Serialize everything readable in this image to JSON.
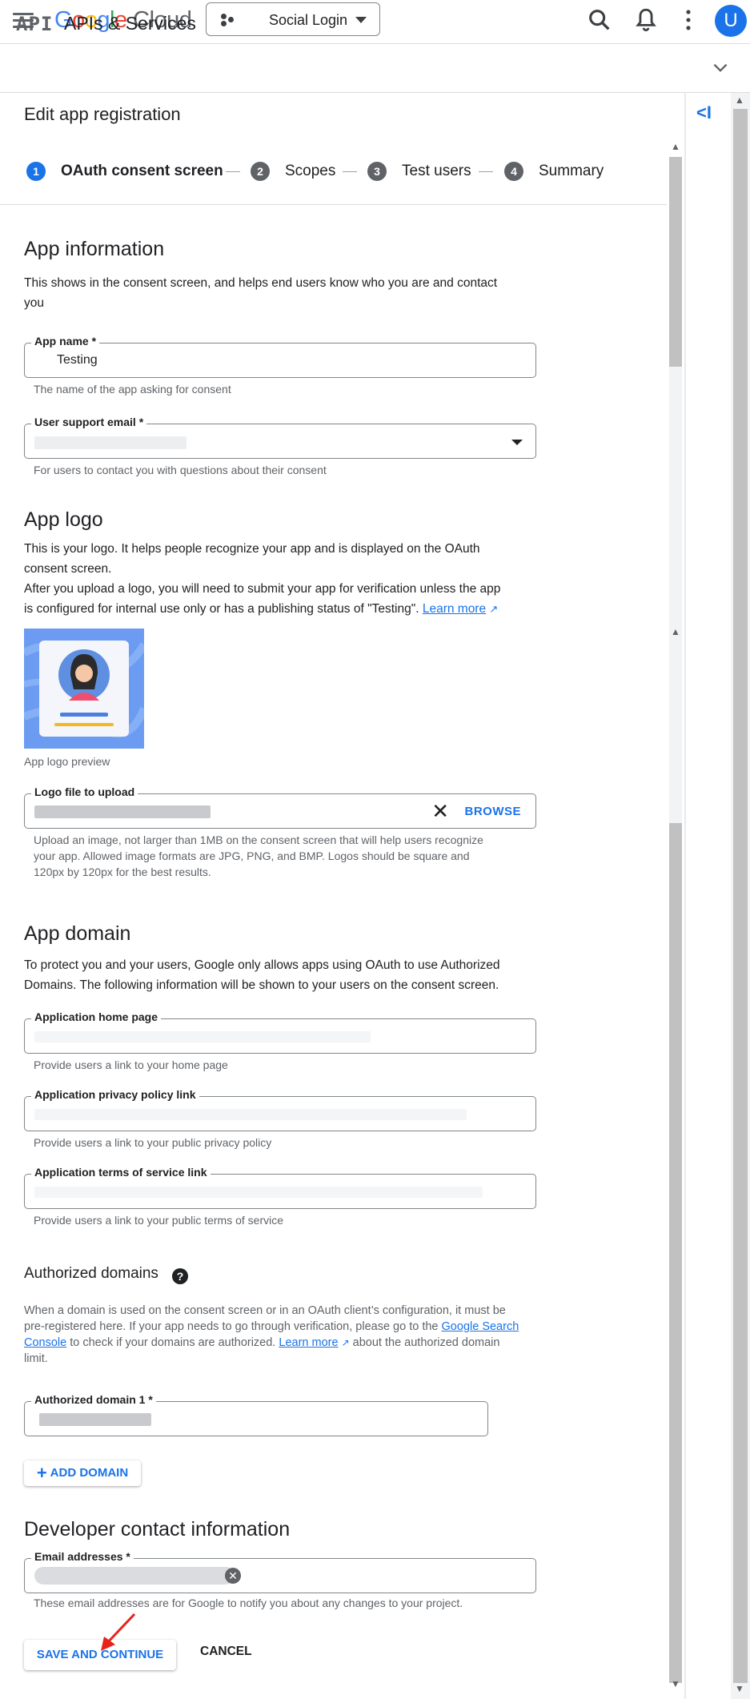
{
  "topbar": {
    "logo_google": "Google",
    "logo_cloud": "Cloud",
    "project_name": "Social Login",
    "avatar_initial": "U"
  },
  "api_bar": {
    "logo_text": "API",
    "title": "APIs & Services"
  },
  "page": {
    "title": "Edit app registration"
  },
  "stepper": [
    {
      "num": "1",
      "label": "OAuth consent screen",
      "active": true
    },
    {
      "num": "2",
      "label": "Scopes",
      "active": false
    },
    {
      "num": "3",
      "label": "Test users",
      "active": false
    },
    {
      "num": "4",
      "label": "Summary",
      "active": false
    }
  ],
  "app_info": {
    "heading": "App information",
    "desc_line1": "This shows in the consent screen, and helps end users know who you are and contact",
    "desc_line2": "you",
    "app_name_label": "App name *",
    "app_name_value": "Testing",
    "app_name_hint": "The name of the app asking for consent",
    "support_email_label": "User support email *",
    "support_email_hint": "For users to contact you with questions about their consent"
  },
  "app_logo": {
    "heading": "App logo",
    "desc_line1": "This is your logo. It helps people recognize your app and is displayed on the OAuth",
    "desc_line2": "consent screen.",
    "desc_line3": "After you upload a logo, you will need to submit your app for verification unless the app",
    "desc_line4": "is configured for internal use only or has a publishing status of \"Testing\".",
    "learn_more": "Learn more",
    "preview_caption": "App logo preview",
    "file_label": "Logo file to upload",
    "browse_label": "BROWSE",
    "hint_line1": "Upload an image, not larger than 1MB on the consent screen that will help users recognize",
    "hint_line2": "your app. Allowed image formats are JPG, PNG, and BMP. Logos should be square and",
    "hint_line3": "120px by 120px for the best results."
  },
  "app_domain": {
    "heading": "App domain",
    "desc_line1": "To protect you and your users, Google only allows apps using OAuth to use Authorized",
    "desc_line2": "Domains. The following information will be shown to your users on the consent screen.",
    "home_label": "Application home page",
    "home_hint": "Provide users a link to your home page",
    "privacy_label": "Application privacy policy link",
    "privacy_hint": "Provide users a link to your public privacy policy",
    "tos_label": "Application terms of service link",
    "tos_hint": "Provide users a link to your public terms of service"
  },
  "authorized_domains": {
    "heading": "Authorized domains",
    "help_icon": "?",
    "desc_line1": "When a domain is used on the consent screen or in an OAuth client’s configuration, it must be",
    "desc_line2a": "pre-registered here. If your app needs to go through verification, please go to the",
    "desc_link1a": "Google Search",
    "desc_link1b": "Console",
    "desc_line3a": "to check if your domains are authorized.",
    "desc_link2": "Learn more",
    "desc_line3b": "about the authorized domain",
    "desc_line4": "limit.",
    "domain1_label": "Authorized domain 1 *",
    "add_domain_label": "ADD DOMAIN"
  },
  "developer_contact": {
    "heading": "Developer contact information",
    "email_label": "Email addresses *",
    "hint": "These email addresses are for Google to notify you about any changes to your project.",
    "save_label": "SAVE AND CONTINUE",
    "cancel_label": "CANCEL"
  },
  "colors": {
    "accent": "#1a73e8",
    "text": "#202124",
    "muted": "#5f6368",
    "border": "#dadce0"
  }
}
